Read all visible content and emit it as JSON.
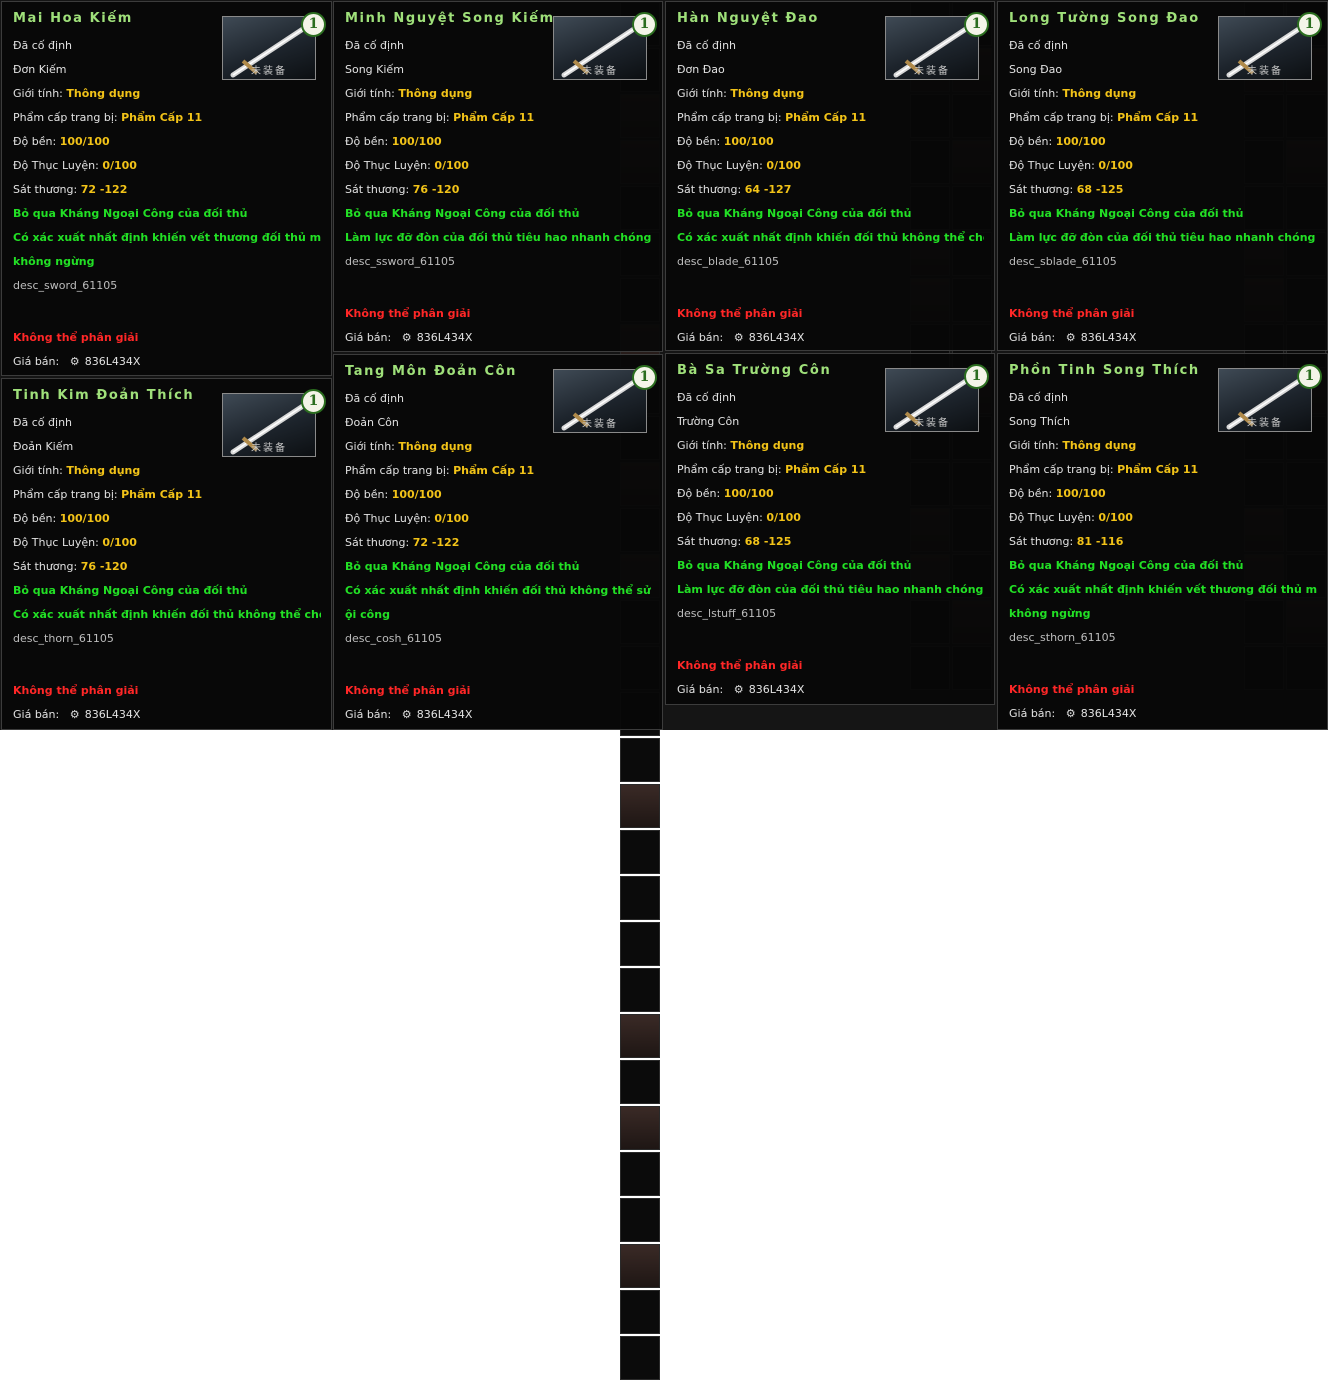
{
  "labels": {
    "durability": "Độ bền: ",
    "refine": "Độ Thục Luyện: ",
    "damage": "Sát thương: ",
    "gender": "Giới tính: ",
    "grade": "Phẩm cấp trang bị: ",
    "price": "Giá bán: "
  },
  "items": [
    {
      "name": "Mai Hoa Kiếm",
      "bound": "Đã cố định",
      "type": "Đơn Kiếm",
      "gender": "Thông dụng",
      "grade": "Phẩm Cấp 11",
      "durability": "100/100",
      "refine": "0/100",
      "damage": "72 -122",
      "effects": [
        "Bỏ qua Kháng Ngoại Công của đối thủ",
        "Có xác xuất nhất định khiến vết thương đối thủ mất máu",
        "không ngừng"
      ],
      "desc": "desc_sword_61105",
      "no_decompose": "Không thể phân giải",
      "price": "836L434X",
      "thumb_label": "未装备",
      "badge": "1"
    },
    {
      "name": "Minh Nguyệt Song Kiếm",
      "bound": "Đã cố định",
      "type": "Song Kiếm",
      "gender": "Thông dụng",
      "grade": "Phẩm Cấp 11",
      "durability": "100/100",
      "refine": "0/100",
      "damage": "76 -120",
      "effects": [
        "Bỏ qua Kháng Ngoại Công của đối thủ",
        "Làm lực đỡ đòn của đối thủ tiêu hao nhanh chóng"
      ],
      "desc": "desc_ssword_61105",
      "no_decompose": "Không thể phân giải",
      "price": "836L434X",
      "thumb_label": "未装备",
      "badge": "1"
    },
    {
      "name": "Hàn Nguyệt Đao",
      "bound": "Đã cố định",
      "type": "Đơn Đao",
      "gender": "Thông dụng",
      "grade": "Phẩm Cấp 11",
      "durability": "100/100",
      "refine": "0/100",
      "damage": "64 -127",
      "effects": [
        "Bỏ qua Kháng Ngoại Công của đối thủ",
        "Có xác xuất nhất định khiến đối thủ không thể chống đỡ"
      ],
      "desc": "desc_blade_61105",
      "no_decompose": "Không thể phân giải",
      "price": "836L434X",
      "thumb_label": "未装备",
      "badge": "1"
    },
    {
      "name": "Long Tường Song Đao",
      "bound": "Đã cố định",
      "type": "Song Đao",
      "gender": "Thông dụng",
      "grade": "Phẩm Cấp 11",
      "durability": "100/100",
      "refine": "0/100",
      "damage": "68 -125",
      "effects": [
        "Bỏ qua Kháng Ngoại Công của đối thủ",
        "Làm lực đỡ đòn của đối thủ tiêu hao nhanh chóng"
      ],
      "desc": "desc_sblade_61105",
      "no_decompose": "Không thể phân giải",
      "price": "836L434X",
      "thumb_label": "未装备",
      "badge": "1"
    },
    {
      "name": "Tinh Kim Đoản Thích",
      "bound": "Đã cố định",
      "type": "Đoản Kiếm",
      "gender": "Thông dụng",
      "grade": "Phẩm Cấp 11",
      "durability": "100/100",
      "refine": "0/100",
      "damage": "76 -120",
      "effects": [
        "Bỏ qua Kháng Ngoại Công của đối thủ",
        "Có xác xuất nhất định khiến đối thủ không thể chống đỡ"
      ],
      "desc": "desc_thorn_61105",
      "no_decompose": "Không thể phân giải",
      "price": "836L434X",
      "thumb_label": "未装备",
      "badge": "1"
    },
    {
      "name": "Tang Môn Đoản Côn",
      "bound": "Đã cố định",
      "type": "Đoản Côn",
      "gender": "Thông dụng",
      "grade": "Phẩm Cấp 11",
      "durability": "100/100",
      "refine": "0/100",
      "damage": "72 -122",
      "effects": [
        "Bỏ qua Kháng Ngoại Công của đối thủ",
        "Có xác xuất nhất định khiến đối thủ không thể sử dụng n",
        "ội công"
      ],
      "desc": "desc_cosh_61105",
      "no_decompose": "Không thể phân giải",
      "price": "836L434X",
      "thumb_label": "未装备",
      "badge": "1"
    },
    {
      "name": "Bà Sa Trường Côn",
      "bound": "Đã cố định",
      "type": "Trường Côn",
      "gender": "Thông dụng",
      "grade": "Phẩm Cấp 11",
      "durability": "100/100",
      "refine": "0/100",
      "damage": "68 -125",
      "effects": [
        "Bỏ qua Kháng Ngoại Công của đối thủ",
        "Làm lực đỡ đòn của đối thủ tiêu hao nhanh chóng"
      ],
      "desc": "desc_lstuff_61105",
      "no_decompose": "Không thể phân giải",
      "price": "836L434X",
      "thumb_label": "未装备",
      "badge": "1"
    },
    {
      "name": "Phồn Tinh Song Thích",
      "bound": "Đã cố định",
      "type": "Song Thích",
      "gender": "Thông dụng",
      "grade": "Phẩm Cấp 11",
      "durability": "100/100",
      "refine": "0/100",
      "damage": "81 -116",
      "effects": [
        "Bỏ qua Kháng Ngoại Công của đối thủ",
        "Có xác xuất nhất định khiến vết thương đối thủ mất máu",
        "không ngừng"
      ],
      "desc": "desc_sthorn_61105",
      "no_decompose": "Không thể phân giải",
      "price": "836L434X",
      "thumb_label": "未装备",
      "badge": "1"
    }
  ]
}
